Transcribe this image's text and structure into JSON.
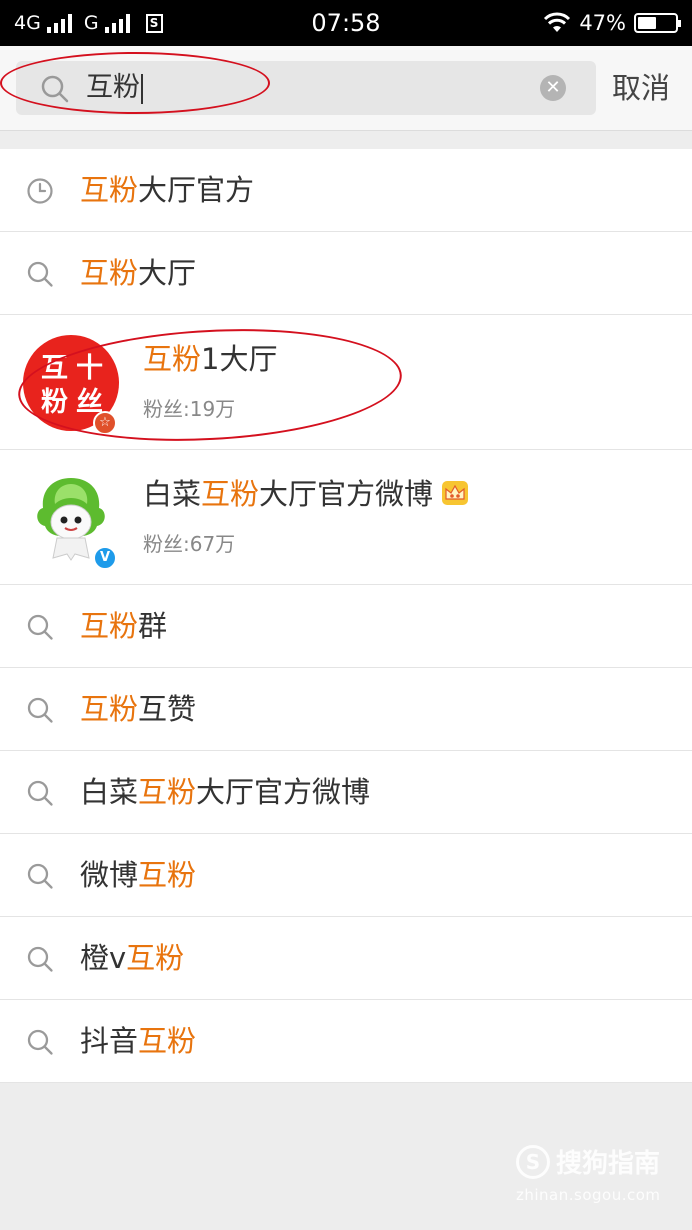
{
  "status_bar": {
    "network_1": "4G",
    "network_2": "G",
    "sim_label": "S",
    "time": "07:58",
    "battery": "47%",
    "battery_level": 0.47
  },
  "search": {
    "query": "互粉",
    "cancel_label": "取消"
  },
  "suggestions": [
    {
      "icon": "clock-icon",
      "parts": [
        {
          "t": "互粉",
          "h": true
        },
        {
          "t": "大厅官方",
          "h": false
        }
      ]
    },
    {
      "icon": "search-icon",
      "parts": [
        {
          "t": "互粉",
          "h": true
        },
        {
          "t": "大厅",
          "h": false
        }
      ]
    }
  ],
  "users": [
    {
      "name_parts": [
        {
          "t": "互粉",
          "h": true
        },
        {
          "t": "1大厅",
          "h": false
        }
      ],
      "fans": "粉丝:19万",
      "avatar_text": [
        "互",
        "十",
        "粉",
        "丝"
      ],
      "badge": "☆",
      "badge_color": "#e0502b"
    },
    {
      "name_parts": [
        {
          "t": "白菜",
          "h": false
        },
        {
          "t": "互粉",
          "h": true
        },
        {
          "t": "大厅官方微博",
          "h": false
        }
      ],
      "fans": "粉丝:67万",
      "badge": "V",
      "badge_color": "#1e9bea"
    }
  ],
  "more_suggestions": [
    {
      "icon": "search-icon",
      "parts": [
        {
          "t": "互粉",
          "h": true
        },
        {
          "t": "群",
          "h": false
        }
      ]
    },
    {
      "icon": "search-icon",
      "parts": [
        {
          "t": "互粉",
          "h": true
        },
        {
          "t": "互赞",
          "h": false
        }
      ]
    },
    {
      "icon": "search-icon",
      "parts": [
        {
          "t": "白菜",
          "h": false
        },
        {
          "t": "互粉",
          "h": true
        },
        {
          "t": "大厅官方微博",
          "h": false
        }
      ]
    },
    {
      "icon": "search-icon",
      "parts": [
        {
          "t": "微博",
          "h": false
        },
        {
          "t": "互粉",
          "h": true
        }
      ]
    },
    {
      "icon": "search-icon",
      "parts": [
        {
          "t": "橙v",
          "h": false
        },
        {
          "t": "互粉",
          "h": true
        }
      ]
    },
    {
      "icon": "search-icon",
      "parts": [
        {
          "t": "抖音",
          "h": false
        },
        {
          "t": "互粉",
          "h": true
        }
      ]
    }
  ],
  "colors": {
    "highlight": "#e8740e",
    "annotation": "#d4101e"
  },
  "watermark": {
    "logo_letter": "S",
    "brand": "搜狗指南",
    "url": "zhinan.sogou.com"
  }
}
